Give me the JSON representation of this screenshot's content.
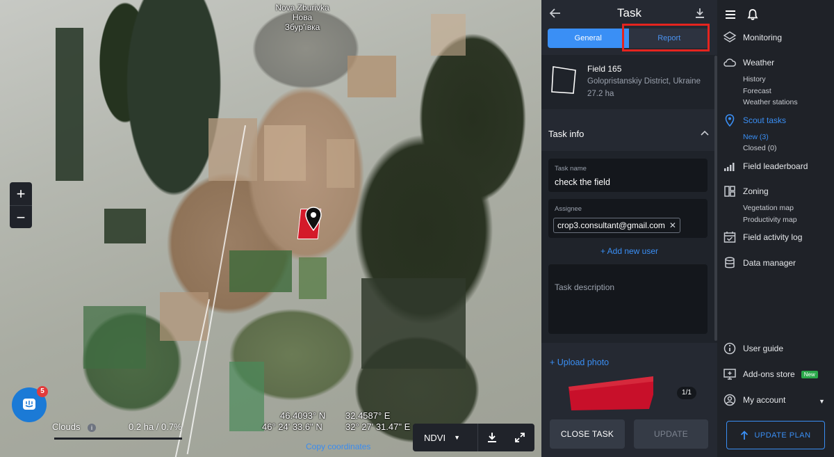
{
  "map": {
    "place_label_en": "Nova Zburivka",
    "place_label_local_1": "Нова",
    "place_label_local_2": "Збур'ївка",
    "zoom_in": "+",
    "zoom_out": "−",
    "chat_badge_count": "5",
    "clouds_label": "Clouds",
    "clouds_info": "i",
    "clouds_value": "0.2 ha / 0.7%",
    "lat_decimal": "46.4093° N",
    "lon_decimal": "32.4587° E",
    "lat_dms": "46° 24' 33.6\" N",
    "lon_dms": "32° 27' 31.47\" E",
    "copy_coordinates": "Copy coordinates",
    "layer": "NDVI"
  },
  "task_panel": {
    "title": "Task",
    "tabs": [
      {
        "label": "General",
        "active": true
      },
      {
        "label": "Report",
        "active": false
      }
    ],
    "field": {
      "name": "Field 165",
      "location": "Golopristanskiy District, Ukraine",
      "area": "27.2 ha"
    },
    "section_title": "Task info",
    "task_name_label": "Task name",
    "task_name_value": "check the field",
    "assignee_label": "Assignee",
    "assignee_value": "crop3.consultant@gmail.com",
    "add_user": "+ Add new user",
    "description_placeholder": "Task description",
    "upload_photo": "+ Upload photo",
    "photo_count": "1/1",
    "close_task": "CLOSE TASK",
    "update": "UPDATE"
  },
  "nav": {
    "items": {
      "monitoring": "Monitoring",
      "weather": "Weather",
      "weather_history": "History",
      "weather_forecast": "Forecast",
      "weather_stations": "Weather stations",
      "scout_tasks": "Scout tasks",
      "scout_new": "New (3)",
      "scout_closed": "Closed (0)",
      "field_leaderboard": "Field leaderboard",
      "zoning": "Zoning",
      "vegetation_map": "Vegetation map",
      "productivity_map": "Productivity map",
      "field_activity_log": "Field activity log",
      "data_manager": "Data manager",
      "user_guide": "User guide",
      "addons_store": "Add-ons store",
      "addons_new_tag": "New",
      "my_account": "My account"
    },
    "update_plan": "UPDATE PLAN"
  },
  "colors": {
    "accent": "#3a8ff5",
    "highlight": "#e5241f",
    "field_red": "#d41a2a"
  }
}
